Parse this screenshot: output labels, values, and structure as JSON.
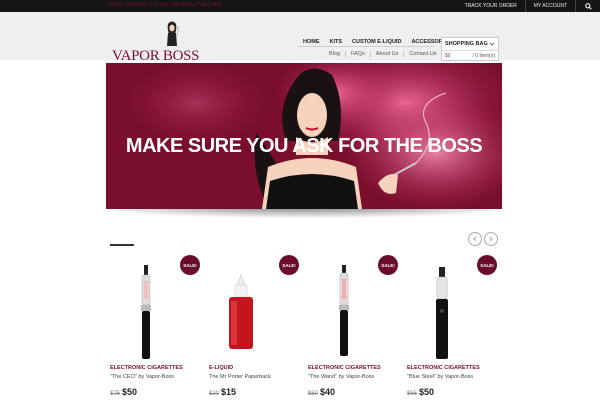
{
  "topbar": {
    "promo": "Free shipping on all orders over $60",
    "track_order": "Track Your Order",
    "my_account": "My Account"
  },
  "logo": {
    "text": "VAPOR BOSS"
  },
  "mainnav": [
    "HOME",
    "KITS",
    "CUSTOM E-LIQUID",
    "ACCESSORIES"
  ],
  "subnav": [
    "Blog",
    "FAQs",
    "About Us",
    "Contact Us"
  ],
  "bag": {
    "title": "SHOPPING BAG",
    "total": "$0",
    "items": "/ 0 Item(s)"
  },
  "hero": {
    "headline": "MAKE SURE YOU ASK FOR THE BOSS"
  },
  "products": [
    {
      "badge": "SALE!",
      "category": "ELECTRONIC CIGARETTES",
      "name": "\"The CEO\" by Vapor-Boss",
      "old_price": "$75",
      "price": "$50"
    },
    {
      "badge": "SALE!",
      "category": "E-LIQUID",
      "name": "The Mr Porter Paperback",
      "old_price": "$20",
      "price": "$15"
    },
    {
      "badge": "SALE!",
      "category": "ELECTRONIC CIGARETTES",
      "name": "\"The Wand\" by Vapor-Boss",
      "old_price": "$50",
      "price": "$40"
    },
    {
      "badge": "SALE!",
      "category": "ELECTRONIC CIGARETTES",
      "name": "\"Blue Steel\" by Vapor-Boss",
      "old_price": "$65",
      "price": "$50"
    }
  ],
  "colors": {
    "brand": "#7a1030",
    "hero_bg": "#7a0f2d",
    "badge": "#6b0d2a",
    "topbar": "#151515"
  }
}
